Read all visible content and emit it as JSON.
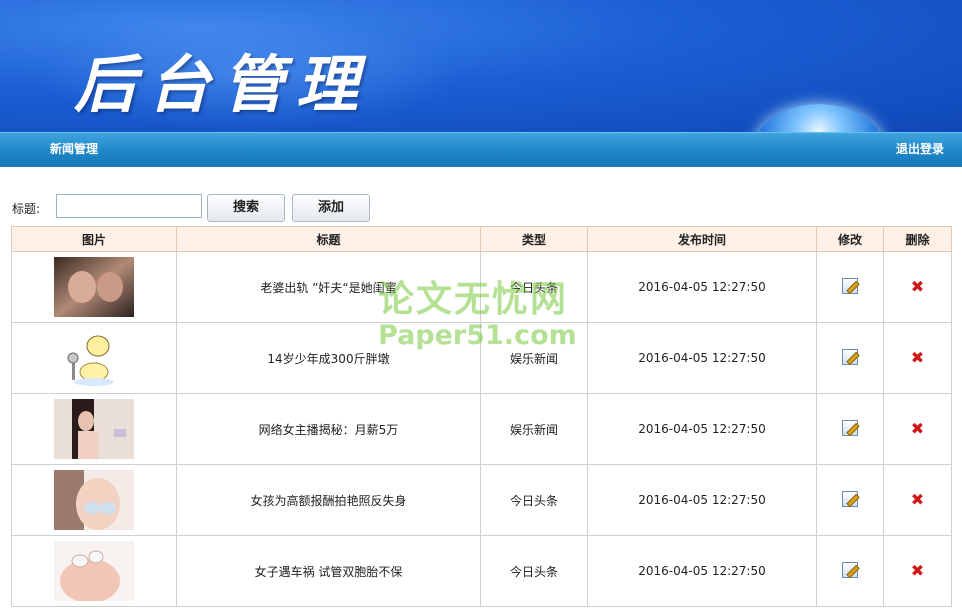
{
  "header": {
    "title": "后台管理"
  },
  "nav": {
    "news_label": "新闻管理",
    "logout_label": "退出登录"
  },
  "search": {
    "label": "标题:",
    "value": "",
    "placeholder": "",
    "search_label": "搜索",
    "add_label": "添加"
  },
  "table": {
    "columns": [
      "图片",
      "标题",
      "类型",
      "发布时间",
      "修改",
      "删除"
    ],
    "rows": [
      {
        "title": "老婆出轨 ”奸夫“是她闺蜜",
        "type": "今日头条",
        "time": "2016-04-05 12:27:50"
      },
      {
        "title": "14岁少年成300斤胖墩",
        "type": "娱乐新闻",
        "time": "2016-04-05 12:27:50"
      },
      {
        "title": "网络女主播揭秘：月薪5万",
        "type": "娱乐新闻",
        "time": "2016-04-05 12:27:50"
      },
      {
        "title": "女孩为高额报酬拍艳照反失身",
        "type": "今日头条",
        "time": "2016-04-05 12:27:50"
      },
      {
        "title": "女子遇车祸 试管双胞胎不保",
        "type": "今日头条",
        "time": "2016-04-05 12:27:50"
      }
    ]
  },
  "watermark": {
    "line1": "论文无忧网",
    "line2": "Paper51.com"
  },
  "colors": {
    "banner": "#1b5fd4",
    "navbar": "#1f86c8",
    "table_header_bg": "#fdf0e6",
    "delete_icon": "#d01818"
  }
}
